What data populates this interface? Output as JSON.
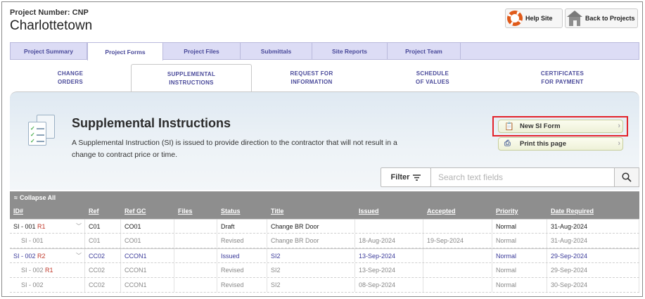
{
  "header": {
    "project_number": "Project Number: CNP",
    "project_name": "Charlottetown",
    "help_label": "Help Site",
    "back_label": "Back to Projects"
  },
  "main_tabs": [
    {
      "label": "Project Summary",
      "active": false
    },
    {
      "label": "Project Forms",
      "active": true
    },
    {
      "label": "Project Files",
      "active": false
    },
    {
      "label": "Submittals",
      "active": false
    },
    {
      "label": "Site Reports",
      "active": false
    },
    {
      "label": "Project Team",
      "active": false
    }
  ],
  "sub_tabs": [
    {
      "line1": "CHANGE",
      "line2": "ORDERS",
      "active": false
    },
    {
      "line1": "SUPPLEMENTAL",
      "line2": "INSTRUCTIONS",
      "active": true
    },
    {
      "line1": "REQUEST FOR",
      "line2": "INFORMATION",
      "active": false
    },
    {
      "line1": "SCHEDULE",
      "line2": "OF VALUES",
      "active": false
    },
    {
      "line1": "CERTIFICATES",
      "line2": "FOR PAYMENT",
      "active": false
    }
  ],
  "panel": {
    "title": "Supplemental Instructions",
    "description": "A Supplemental Instruction (SI) is issued to provide direction to the contractor that will not result in a change to contract price or time.",
    "new_form_label": "New SI Form",
    "print_label": "Print this page",
    "filter_label": "Filter",
    "search_placeholder": "Search text fields"
  },
  "table": {
    "collapse_label": "Collapse All",
    "columns": [
      "ID#",
      "Ref",
      "Ref GC",
      "Files",
      "Status",
      "Title",
      "Issued",
      "Accepted",
      "Priority",
      "Date Required"
    ],
    "rows": [
      {
        "kind": "parent",
        "id": "SI - 001",
        "rev": "R1",
        "ref": "C01",
        "ref_gc": "CO01",
        "files": "",
        "status": "Draft",
        "title": "Change BR Door",
        "issued": "",
        "accepted": "",
        "priority": "Normal",
        "date_required": "31-Aug-2024"
      },
      {
        "kind": "child",
        "id": "SI - 001",
        "rev": "",
        "ref": "C01",
        "ref_gc": "CO01",
        "files": "",
        "status": "Revised",
        "title": "Change BR Door",
        "issued": "18-Aug-2024",
        "accepted": "19-Sep-2024",
        "priority": "Normal",
        "date_required": "31-Aug-2024"
      },
      {
        "kind": "parent issued",
        "id": "SI - 002",
        "rev": "R2",
        "ref": "CC02",
        "ref_gc": "CCON1",
        "files": "",
        "status": "Issued",
        "title": "SI2",
        "issued": "13-Sep-2024",
        "accepted": "",
        "priority": "Normal",
        "date_required": "29-Sep-2024"
      },
      {
        "kind": "child",
        "id": "SI - 002",
        "rev": "R1",
        "ref": "CC02",
        "ref_gc": "CCON1",
        "files": "",
        "status": "Revised",
        "title": "SI2",
        "issued": "13-Sep-2024",
        "accepted": "",
        "priority": "Normal",
        "date_required": "29-Sep-2024"
      },
      {
        "kind": "child",
        "id": "SI - 002",
        "rev": "",
        "ref": "CC02",
        "ref_gc": "CCON1",
        "files": "",
        "status": "Revised",
        "title": "SI2",
        "issued": "08-Sep-2024",
        "accepted": "",
        "priority": "Normal",
        "date_required": "30-Sep-2024"
      }
    ]
  },
  "colors": {
    "tab_bg": "#dcdcf5",
    "tab_text": "#4a4a9a",
    "highlight": "#e3222a",
    "table_header": "#8e8e8e",
    "revision": "#c0392b"
  },
  "icons": [
    "lifebuoy-icon",
    "house-icon",
    "document-checklist-icon",
    "clipboard-icon",
    "printer-icon",
    "filter-icon",
    "search-icon",
    "chevron-right-icon",
    "chevron-up-icon",
    "chevron-down-icon"
  ]
}
